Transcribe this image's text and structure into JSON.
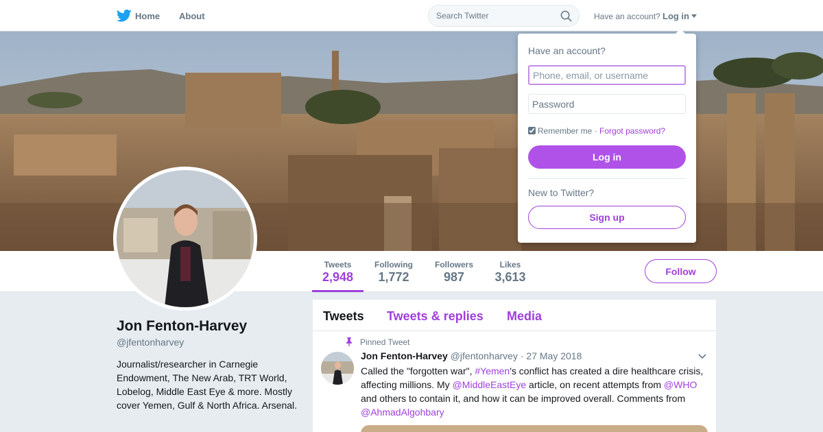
{
  "topnav": {
    "brand_icon": "twitter-bird-icon",
    "home_label": "Home",
    "about_label": "About",
    "search_placeholder": "Search Twitter",
    "have_account": "Have an account?",
    "login_label": "Log in"
  },
  "profile": {
    "name": "Jon Fenton-Harvey",
    "handle": "@jfentonharvey",
    "bio": "Journalist/researcher in Carnegie Endowment, The New Arab, TRT World, Lobelog, Middle East Eye & more. Mostly cover Yemen, Gulf & North Africa. Arsenal."
  },
  "stats": [
    {
      "label": "Tweets",
      "value": "2,948",
      "active": true
    },
    {
      "label": "Following",
      "value": "1,772"
    },
    {
      "label": "Followers",
      "value": "987"
    },
    {
      "label": "Likes",
      "value": "3,613"
    }
  ],
  "follow_label": "Follow",
  "timeline": {
    "tabs": [
      "Tweets",
      "Tweets & replies",
      "Media"
    ],
    "active_tab": "Tweets",
    "pinned_label": "Pinned Tweet",
    "tweet": {
      "author_name": "Jon Fenton-Harvey",
      "author_handle": "@jfentonharvey",
      "date": "· 27 May 2018",
      "text_parts": [
        {
          "text": "Called the \"forgotten war\", "
        },
        {
          "text": "#Yemen",
          "link": true
        },
        {
          "text": "'s conflict has created a dire healthcare crisis, affecting millions. My "
        },
        {
          "text": "@MiddleEastEye",
          "link": true
        },
        {
          "text": " article, on recent attempts from "
        },
        {
          "text": "@WHO",
          "link": true
        },
        {
          "text": " and others to contain it, and how it can be improved overall. Comments from "
        },
        {
          "text": "@AhmadAlgohbary",
          "link": true
        }
      ]
    }
  },
  "login_dropdown": {
    "title": "Have an account?",
    "username_placeholder": "Phone, email, or username",
    "password_placeholder": "Password",
    "remember_label": "Remember me",
    "separator": "·",
    "forgot_label": "Forgot password?",
    "remember_checked": true,
    "login_button": "Log in",
    "new_label": "New to Twitter?",
    "signup_button": "Sign up"
  },
  "colors": {
    "accent": "#9f3fdb",
    "login_button": "#b052e8",
    "muted_text": "#657786",
    "page_background": "#e6ecf0",
    "brand_icon": "#1da1f2"
  }
}
